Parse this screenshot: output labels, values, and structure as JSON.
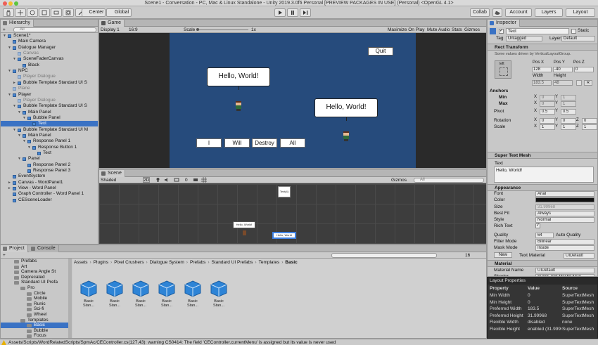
{
  "window": {
    "title": "Scene1 - Conversation - PC, Mac & Linux Standalone - Unity 2019.3.0f6 Personal [PREVIEW PACKAGES IN USE] (Personal) <OpenGL 4.1>"
  },
  "toolbar": {
    "pivot_label": "Center",
    "space_label": "Global",
    "collab_label": "Collab",
    "account_label": "Account",
    "layers_label": "Layers",
    "layout_label": "Layout",
    "play_icon": "play-icon",
    "pause_icon": "pause-icon",
    "step_icon": "step-icon"
  },
  "hierarchy": {
    "tab": "Hierarchy",
    "create_label": "+",
    "search_placeholder": "All",
    "items": [
      {
        "label": "Scene1*",
        "depth": 0,
        "toggle": "▼",
        "icon": "unity-scene",
        "selected": false,
        "dim": false
      },
      {
        "label": "Main Camera",
        "depth": 1,
        "toggle": "",
        "icon": "cube",
        "selected": false,
        "dim": false
      },
      {
        "label": "Dialogue Manager",
        "depth": 1,
        "toggle": "▼",
        "icon": "cube",
        "selected": false,
        "dim": false
      },
      {
        "label": "Canvas",
        "depth": 2,
        "toggle": "",
        "icon": "cube",
        "selected": false,
        "dim": true
      },
      {
        "label": "SceneFaderCanvas",
        "depth": 2,
        "toggle": "▼",
        "icon": "cube",
        "selected": false,
        "dim": false
      },
      {
        "label": "Black",
        "depth": 3,
        "toggle": "",
        "icon": "cube",
        "selected": false,
        "dim": false
      },
      {
        "label": "NPC",
        "depth": 1,
        "toggle": "▼",
        "icon": "cube",
        "selected": false,
        "dim": false
      },
      {
        "label": "Player Dialogue",
        "depth": 2,
        "toggle": "",
        "icon": "cube",
        "selected": false,
        "dim": true
      },
      {
        "label": "Bubble Template Standard UI S",
        "depth": 2,
        "toggle": "►",
        "icon": "cube",
        "selected": false,
        "dim": false
      },
      {
        "label": "Plane",
        "depth": 1,
        "toggle": "",
        "icon": "cube",
        "selected": false,
        "dim": true
      },
      {
        "label": "Player",
        "depth": 1,
        "toggle": "▼",
        "icon": "cube",
        "selected": false,
        "dim": false
      },
      {
        "label": "Player Dialogue",
        "depth": 2,
        "toggle": "",
        "icon": "cube",
        "selected": false,
        "dim": true
      },
      {
        "label": "Bubble Template Standard UI S",
        "depth": 2,
        "toggle": "▼",
        "icon": "cube",
        "selected": false,
        "dim": false
      },
      {
        "label": "Main Panel",
        "depth": 3,
        "toggle": "▼",
        "icon": "cube",
        "selected": false,
        "dim": false
      },
      {
        "label": "Bubble Panel",
        "depth": 4,
        "toggle": "▼",
        "icon": "cube",
        "selected": false,
        "dim": false
      },
      {
        "label": "Text",
        "depth": 5,
        "toggle": "",
        "icon": "cube",
        "selected": true,
        "dim": false
      },
      {
        "label": "Bubble Template Standard UI M",
        "depth": 2,
        "toggle": "▼",
        "icon": "cube",
        "selected": false,
        "dim": false
      },
      {
        "label": "Main Panel",
        "depth": 3,
        "toggle": "▼",
        "icon": "cube",
        "selected": false,
        "dim": false
      },
      {
        "label": "Response Panel 1",
        "depth": 4,
        "toggle": "▼",
        "icon": "cube",
        "selected": false,
        "dim": false
      },
      {
        "label": "Response Button 1",
        "depth": 5,
        "toggle": "▼",
        "icon": "cube",
        "selected": false,
        "dim": false
      },
      {
        "label": "Text",
        "depth": 6,
        "toggle": "",
        "icon": "cube",
        "selected": false,
        "dim": false
      },
      {
        "label": "Panel",
        "depth": 3,
        "toggle": "▼",
        "icon": "cube",
        "selected": false,
        "dim": false
      },
      {
        "label": "Response Panel 2",
        "depth": 4,
        "toggle": "",
        "icon": "cube",
        "selected": false,
        "dim": false
      },
      {
        "label": "Response Panel 3",
        "depth": 4,
        "toggle": "",
        "icon": "cube",
        "selected": false,
        "dim": false
      },
      {
        "label": "EventSystem",
        "depth": 1,
        "toggle": "",
        "icon": "cube",
        "selected": false,
        "dim": false
      },
      {
        "label": "Canvas - WordPanel1",
        "depth": 1,
        "toggle": "►",
        "icon": "cube",
        "selected": false,
        "dim": false
      },
      {
        "label": "View - Word Panel",
        "depth": 1,
        "toggle": "►",
        "icon": "cube",
        "selected": false,
        "dim": false
      },
      {
        "label": "Graph Controller - Word Panel 1",
        "depth": 1,
        "toggle": "",
        "icon": "cube",
        "selected": false,
        "dim": false
      },
      {
        "label": "CESceneLoader",
        "depth": 1,
        "toggle": "",
        "icon": "cube",
        "selected": false,
        "dim": false
      }
    ]
  },
  "game": {
    "tab": "Game",
    "display": "Display 1",
    "aspect": "16:9",
    "scale_label": "Scale",
    "scale_value": "1x",
    "maximize": "Maximize On Play",
    "mute": "Mute Audio",
    "stats": "Stats",
    "gizmos": "Gizmos",
    "quit_label": "Quit",
    "bubble1": "Hello, World!",
    "bubble2": "Hello, World!",
    "responses": [
      "I",
      "Will",
      "Destroy",
      "All"
    ]
  },
  "scene": {
    "tab": "Scene",
    "shading": "Shaded",
    "mode2d": "2D",
    "gizmos": "Gizmos",
    "search_placeholder": "All",
    "counter": "0",
    "mini_top": "Text(4)",
    "mini_bubble": "Hello, World!",
    "mini_bottom": "Hello, World"
  },
  "project": {
    "tabs": [
      "Project",
      "Console"
    ],
    "breadcrumb": [
      "Assets",
      "Plugins",
      "Pixel Crushers",
      "Dialogue System",
      "Prefabs",
      "Standard UI Prefabs",
      "Templates",
      "Basic"
    ],
    "count": "16",
    "tree": [
      {
        "label": "Prefabs",
        "depth": 1,
        "selected": false
      },
      {
        "label": "Art",
        "depth": 1,
        "selected": false
      },
      {
        "label": "Camera Angle St",
        "depth": 1,
        "selected": false
      },
      {
        "label": "Deprecated",
        "depth": 1,
        "selected": false
      },
      {
        "label": "Standard UI Prefa",
        "depth": 1,
        "selected": false
      },
      {
        "label": "Pro",
        "depth": 2,
        "selected": false
      },
      {
        "label": "Circle",
        "depth": 3,
        "selected": false
      },
      {
        "label": "Mobile",
        "depth": 3,
        "selected": false
      },
      {
        "label": "Runic",
        "depth": 3,
        "selected": false
      },
      {
        "label": "Sci-fi",
        "depth": 3,
        "selected": false
      },
      {
        "label": "Wheel",
        "depth": 3,
        "selected": false
      },
      {
        "label": "Templates",
        "depth": 2,
        "selected": false
      },
      {
        "label": "Basic",
        "depth": 3,
        "selected": true
      },
      {
        "label": "Bubble",
        "depth": 3,
        "selected": false
      },
      {
        "label": "Focus",
        "depth": 3,
        "selected": false
      }
    ],
    "assets": [
      "Basic Stan...",
      "Basic Stan...",
      "Basic Stan...",
      "Basic Stan...",
      "Basic Stan...",
      "Basic Stan..."
    ]
  },
  "inspector": {
    "tab": "Inspector",
    "object_name": "Text",
    "static_label": "Static",
    "tag_label": "Tag",
    "tag_value": "Untagged",
    "layer_label": "Layer",
    "layer_value": "Default",
    "rect_transform": "Rect Transform",
    "driven_note": "Some values driven by VerticalLayoutGroup.",
    "anchor_preset": "left",
    "pos_x_label": "Pos X",
    "pos_y_label": "Pos Y",
    "pos_z_label": "Pos Z",
    "pos_x": "128",
    "pos_y": "-40",
    "pos_z": "0",
    "width_label": "Width",
    "height_label": "Height",
    "width": "183.5",
    "height": "48",
    "anchors_label": "Anchors",
    "min_label": "Min",
    "max_label": "Max",
    "min_x": "0",
    "min_y": "1",
    "max_x": "0",
    "max_y": "1",
    "pivot_label": "Pivot",
    "pivot_x": "0.5",
    "pivot_y": "0.5",
    "rotation_label": "Rotation",
    "rot_x": "0",
    "rot_y": "0",
    "rot_z": "0",
    "scale_label": "Scale",
    "sc_x": "1",
    "sc_y": "1",
    "sc_z": "1",
    "stm_title": "Super Text Mesh",
    "text_label": "Text",
    "text_value": "Hello, World!",
    "appearance": "Appearance",
    "font_label": "Font",
    "font_value": "Arial",
    "color_label": "Color",
    "size_label": "Size",
    "size_value": "31.99968",
    "bestfit_label": "Best Fit",
    "bestfit_value": "Always",
    "style_label": "Style",
    "style_value": "Normal",
    "richtext_label": "Rich Text",
    "quality_label": "Quality",
    "quality_value": "64",
    "autoquality_label": "Auto Quality",
    "filter_label": "Filter Mode",
    "filter_value": "Bilinear",
    "mask_label": "Mask Mode",
    "mask_value": "Inside",
    "new_label": "New",
    "textmat_label": "Text Material",
    "mat_value": "UIDefault",
    "material_section": "Material",
    "matname_label": "Material Name",
    "matname_value": "UIDefault",
    "shader_label": "Shader",
    "shader_value": "Super Text Mesh/UI/De",
    "cull_label": "Cull Mode",
    "cull_value": "Off",
    "sdf_label": "SDF Mode"
  },
  "layout_props": {
    "title": "Layout Properties",
    "headers": [
      "Property",
      "Value",
      "Source"
    ],
    "rows": [
      [
        "Min Width",
        "0",
        "SuperTextMesh"
      ],
      [
        "Min Height",
        "0",
        "SuperTextMesh"
      ],
      [
        "Preferred Width",
        "183.5",
        "SuperTextMesh"
      ],
      [
        "Preferred Height",
        "31.99968",
        "SuperTextMesh"
      ],
      [
        "Flexible Width",
        "disabled",
        "none"
      ],
      [
        "Flexible Height",
        "enabled (31.99968)",
        "SuperTextMesh"
      ]
    ]
  },
  "status": {
    "message": "Assets/Scripts/WordRelatedScripts/SpmAc/CEController.cs(127,43): warning CS0414: The field 'CEController.currentMenu' is assigned but its value is never used"
  }
}
